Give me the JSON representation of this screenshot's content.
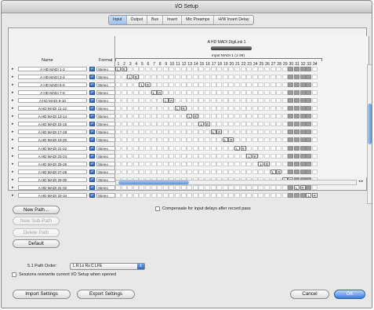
{
  "window": {
    "title": "I/O Setup"
  },
  "tabs": [
    {
      "label": "Input",
      "active": true
    },
    {
      "label": "Output",
      "active": false
    },
    {
      "label": "Bus",
      "active": false
    },
    {
      "label": "Insert",
      "active": false
    },
    {
      "label": "Mic Preamps",
      "active": false
    },
    {
      "label": "H/W Insert Delay",
      "active": false
    }
  ],
  "grid": {
    "device": "A HD MADI DigiLink 1",
    "input_group": "Input MADI 1 (1-28)",
    "headers": {
      "name": "Name",
      "format": "Format"
    },
    "channels": [
      "1",
      "2",
      "3",
      "4",
      "5",
      "6",
      "7",
      "8",
      "9",
      "10",
      "11",
      "12",
      "13",
      "14",
      "15",
      "16",
      "17",
      "18",
      "19",
      "20",
      "21",
      "22",
      "23",
      "24",
      "25",
      "26",
      "27",
      "28",
      "29",
      "30",
      "31",
      "32",
      "33",
      "34"
    ],
    "rows": [
      {
        "name": "A HD MADI 1-2",
        "format": "Stereo",
        "labels": [
          "L",
          "R"
        ]
      },
      {
        "name": "A HD MADI 3-4",
        "format": "Stereo",
        "labels": [
          "L",
          "R"
        ]
      },
      {
        "name": "A HD MADI 5-6",
        "format": "Stereo",
        "labels": [
          "L",
          "R"
        ]
      },
      {
        "name": "A HD MADI 7-8",
        "format": "Stereo",
        "labels": [
          "L",
          "R"
        ]
      },
      {
        "name": "A HD MADI 9-10",
        "format": "Stereo",
        "labels": [
          "L",
          "R"
        ]
      },
      {
        "name": "A HD MADI 11-12",
        "format": "Stereo",
        "labels": [
          "L",
          "R"
        ]
      },
      {
        "name": "A HD MADI 13-14",
        "format": "Stereo",
        "labels": [
          "L",
          "R"
        ]
      },
      {
        "name": "A HD MADI 15-16",
        "format": "Stereo",
        "labels": [
          "L",
          "R"
        ]
      },
      {
        "name": "A HD MADI 17-18",
        "format": "Stereo",
        "labels": [
          "L",
          "R"
        ]
      },
      {
        "name": "A HD MADI 19-20",
        "format": "Stereo",
        "labels": [
          "L",
          "R"
        ]
      },
      {
        "name": "A HD MADI 21-22",
        "format": "Stereo",
        "labels": [
          "L",
          "R"
        ]
      },
      {
        "name": "A HD MADI 23-24",
        "format": "Stereo",
        "labels": [
          "L",
          "R"
        ]
      },
      {
        "name": "A HD MADI 25-26",
        "format": "Stereo",
        "labels": [
          "L",
          "R"
        ]
      },
      {
        "name": "A HD MADI 27-28",
        "format": "Stereo",
        "labels": [
          "L",
          "R"
        ]
      },
      {
        "name": "A HD MADI 29-30",
        "format": "Stereo",
        "labels": [
          "L",
          "R"
        ]
      },
      {
        "name": "A HD MADI 31-32",
        "format": "Stereo",
        "labels": [
          "L",
          "R"
        ]
      },
      {
        "name": "A HD MADI 33-34",
        "format": "Stereo",
        "labels": [
          "L",
          "R"
        ]
      }
    ]
  },
  "buttons": {
    "new_path": "New Path...",
    "new_sub_path": "New Sub-Path",
    "delete_path": "Delete Path",
    "default": "Default",
    "import": "Import Settings",
    "export": "Export Settings",
    "cancel": "Cancel",
    "ok": "OK"
  },
  "options": {
    "compensate": "Compensate for input delays after record pass",
    "path_order_label": "5.1 Path Order:",
    "path_order_value": "L R Ls Rs C LFE",
    "sessions_overwrite": "Sessions overwrite current I/O Setup when opened"
  },
  "colors": {
    "accent": "#3a7bdc",
    "disabled_col": "#9c9c9c"
  }
}
